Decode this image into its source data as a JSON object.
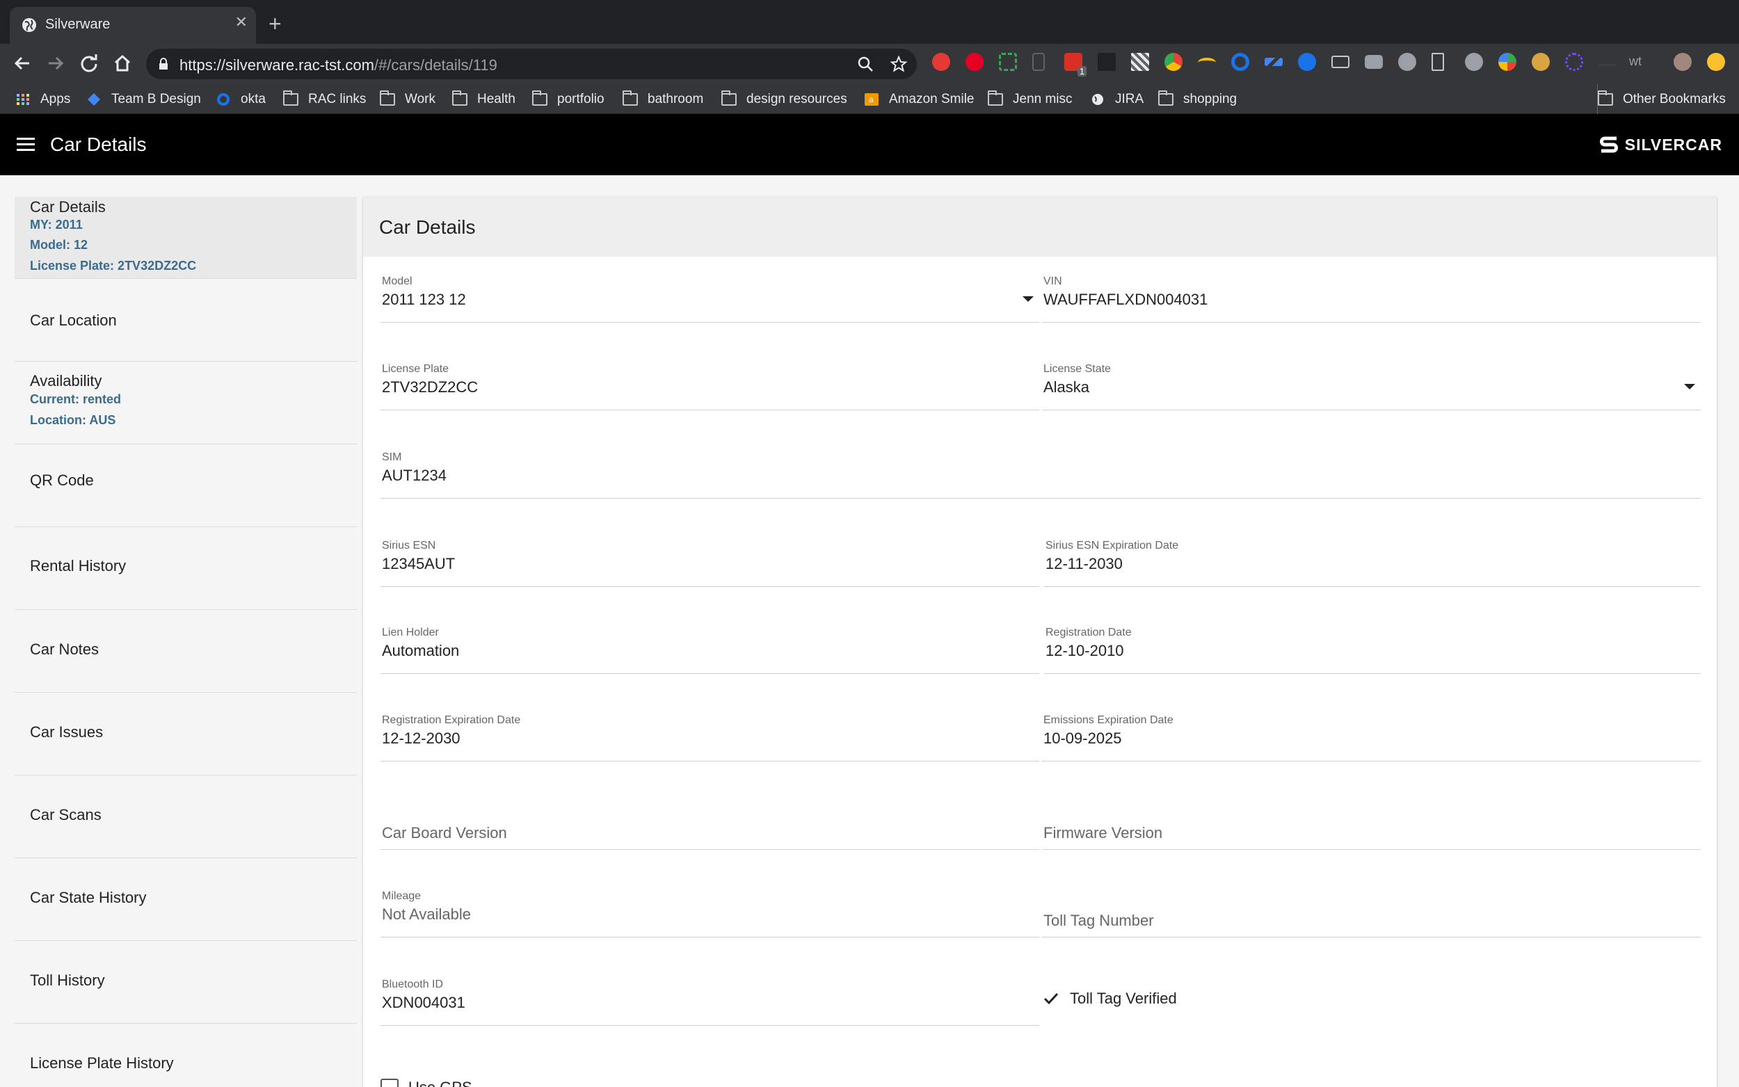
{
  "browser": {
    "tab_title": "Silverware",
    "url_host": "https://silverware.rac-tst.com",
    "url_path": "/#/cars/details/119",
    "extension_badge": "1",
    "bookmarks": [
      {
        "label": "Apps",
        "icon": "apps-grid-icon"
      },
      {
        "label": "Team B Design",
        "icon": "diamond-icon"
      },
      {
        "label": "okta",
        "icon": "okta-icon"
      },
      {
        "label": "RAC links",
        "icon": "folder-icon"
      },
      {
        "label": "Work",
        "icon": "folder-icon"
      },
      {
        "label": "Health",
        "icon": "folder-icon"
      },
      {
        "label": "portfolio",
        "icon": "folder-icon"
      },
      {
        "label": "bathroom",
        "icon": "folder-icon"
      },
      {
        "label": "design resources",
        "icon": "folder-icon"
      },
      {
        "label": "Amazon Smile",
        "icon": "amazon-icon"
      },
      {
        "label": "Jenn misc",
        "icon": "folder-icon"
      },
      {
        "label": "JIRA",
        "icon": "globe-icon"
      },
      {
        "label": "shopping",
        "icon": "folder-icon"
      }
    ],
    "other_bookmarks": "Other Bookmarks"
  },
  "appbar": {
    "title": "Car Details",
    "logo_text": "SILVERCAR"
  },
  "sidebar": {
    "items": [
      {
        "label": "Car Details",
        "sub": [
          "MY: 2011",
          "Model: 12",
          "License Plate: 2TV32DZ2CC"
        ]
      },
      {
        "label": "Car Location"
      },
      {
        "label": "Availability",
        "sub": [
          "Current: rented",
          "Location: AUS"
        ]
      },
      {
        "label": "QR Code"
      },
      {
        "label": "Rental History"
      },
      {
        "label": "Car Notes"
      },
      {
        "label": "Car Issues"
      },
      {
        "label": "Car Scans"
      },
      {
        "label": "Car State History"
      },
      {
        "label": "Toll History"
      },
      {
        "label": "License Plate History"
      }
    ]
  },
  "card": {
    "title": "Car Details",
    "fields": {
      "model": {
        "label": "Model",
        "value": "2011 123 12"
      },
      "vin": {
        "label": "VIN",
        "value": "WAUFFAFLXDN004031"
      },
      "license_plate": {
        "label": "License Plate",
        "value": "2TV32DZ2CC"
      },
      "license_state": {
        "label": "License State",
        "value": "Alaska"
      },
      "sim": {
        "label": "SIM",
        "value": "AUT1234"
      },
      "sirius_esn": {
        "label": "Sirius ESN",
        "value": "12345AUT"
      },
      "sirius_esn_exp": {
        "label": "Sirius ESN Expiration Date",
        "value": "12-11-2030"
      },
      "lien_holder": {
        "label": "Lien Holder",
        "value": "Automation"
      },
      "registration_date": {
        "label": "Registration Date",
        "value": "12-10-2010"
      },
      "registration_exp": {
        "label": "Registration Expiration Date",
        "value": "12-12-2030"
      },
      "emissions_exp": {
        "label": "Emissions Expiration Date",
        "value": "10-09-2025"
      },
      "car_board_version": {
        "placeholder": "Car Board Version"
      },
      "firmware_version": {
        "placeholder": "Firmware Version"
      },
      "mileage": {
        "label": "Mileage",
        "value": "Not Available"
      },
      "toll_tag_number": {
        "placeholder": "Toll Tag Number"
      },
      "bluetooth_id": {
        "label": "Bluetooth ID",
        "value": "XDN004031"
      }
    },
    "toll_tag_verified": {
      "label": "Toll Tag Verified",
      "checked": true
    },
    "use_gps": {
      "label": "Use GPS",
      "checked": false
    }
  }
}
